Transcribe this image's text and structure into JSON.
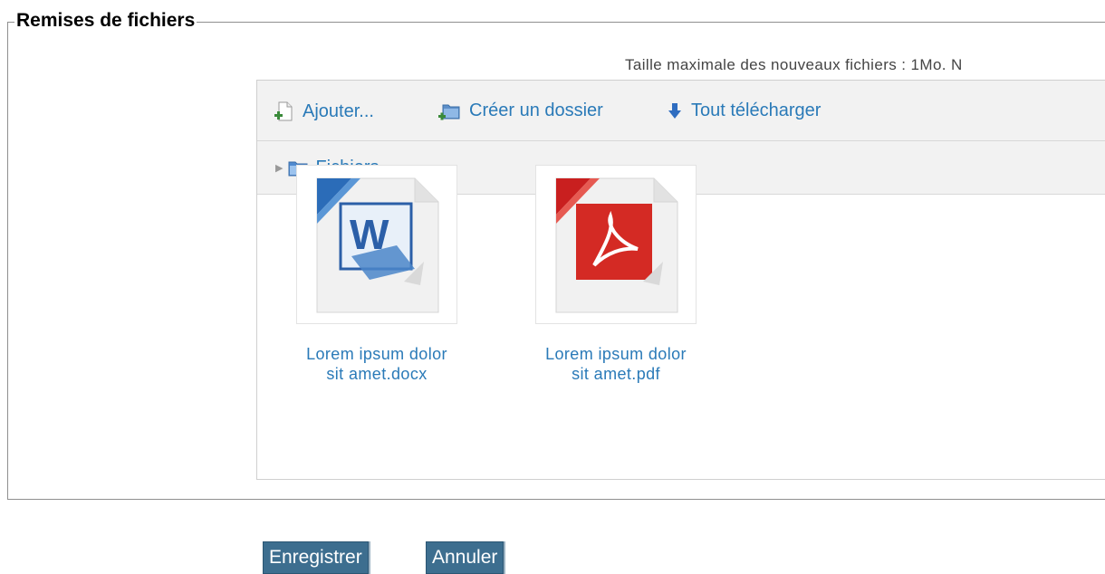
{
  "section": {
    "legend": "Remises de fichiers"
  },
  "limits": {
    "text": "Taille maximale des nouveaux fichiers : 1Mo. N"
  },
  "toolbar": {
    "add_label": "Ajouter...",
    "mkdir_label": "Créer un dossier",
    "download_label": "Tout télécharger"
  },
  "path": {
    "folder_label": "Fichiers"
  },
  "files": [
    {
      "line1": "Lorem ipsum dolor",
      "line2": "sit amet.docx",
      "icon": "word-document-icon"
    },
    {
      "line1": "Lorem ipsum dolor",
      "line2": "sit amet.pdf",
      "icon": "pdf-document-icon"
    }
  ],
  "actions": {
    "save_label": "Enregistrer",
    "cancel_label": "Annuler"
  },
  "colors": {
    "link": "#2a7ab8",
    "button_bg": "#3d6e8f",
    "word_blue": "#2b5fa8",
    "pdf_red": "#d42a24"
  }
}
